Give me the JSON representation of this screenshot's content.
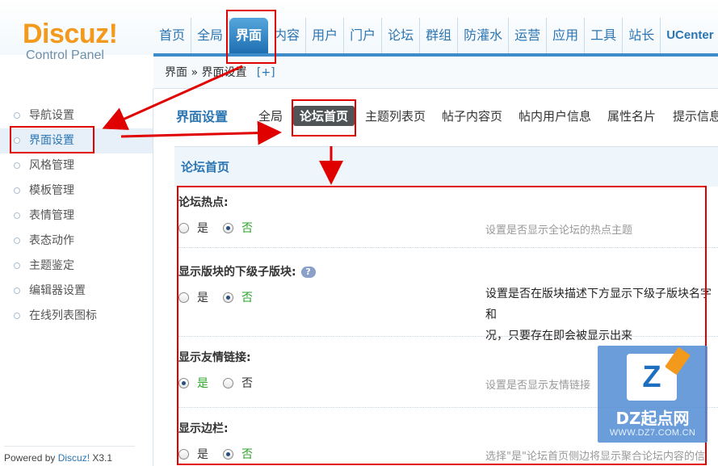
{
  "brand": {
    "logo_main": "Discuz!",
    "logo_sub": "Control Panel",
    "logo_color": "#f29a1d"
  },
  "topnav": {
    "items": [
      "首页",
      "全局",
      "界面",
      "内容",
      "用户",
      "门户",
      "论坛",
      "群组",
      "防灌水",
      "运营",
      "应用",
      "工具",
      "站长",
      "UCenter"
    ],
    "active_index": 2,
    "accent": "#2b75b2"
  },
  "breadcrumb": {
    "text": "界面 » 界面设置",
    "plus": "[+]"
  },
  "sidebar": {
    "items": [
      "导航设置",
      "界面设置",
      "风格管理",
      "模板管理",
      "表情管理",
      "表态动作",
      "主题鉴定",
      "编辑器设置",
      "在线列表图标"
    ],
    "active_index": 1
  },
  "footer": {
    "powered_prefix": "Powered by ",
    "brand": "Discuz!",
    "version": " X3.1"
  },
  "subtabs": {
    "title": "界面设置",
    "items": [
      "全局",
      "论坛首页",
      "主题列表页",
      "帖子内容页",
      "帖内用户信息",
      "属性名片",
      "提示信息"
    ],
    "active_index": 1
  },
  "panel": {
    "title": "论坛首页"
  },
  "settings": [
    {
      "label": "论坛热点:",
      "option_yes": "是",
      "option_no": "否",
      "selected": "no",
      "description": "设置是否显示全论坛的热点主题"
    },
    {
      "label": "显示版块的下级子版块:",
      "help_icon": "question-bubble-icon",
      "help_text": "?",
      "option_yes": "是",
      "option_no": "否",
      "selected": "no",
      "description": "设置是否在版块描述下方显示下级子版块名字和",
      "description_line2": "况，只要存在即会被显示出来"
    },
    {
      "label": "显示友情链接:",
      "option_yes": "是",
      "option_no": "否",
      "selected": "yes",
      "description": "设置是否显示友情链接"
    },
    {
      "label": "显示边栏:",
      "option_yes": "是",
      "option_no": "否",
      "selected": "no",
      "description": "选择\"是\"论坛首页侧边将显示聚合论坛内容的信"
    }
  ],
  "watermark": {
    "mark": "Z",
    "name": "DZ起点网",
    "url": "WWW.DZ7.COM.CN"
  },
  "annotation_color": "#e00000"
}
